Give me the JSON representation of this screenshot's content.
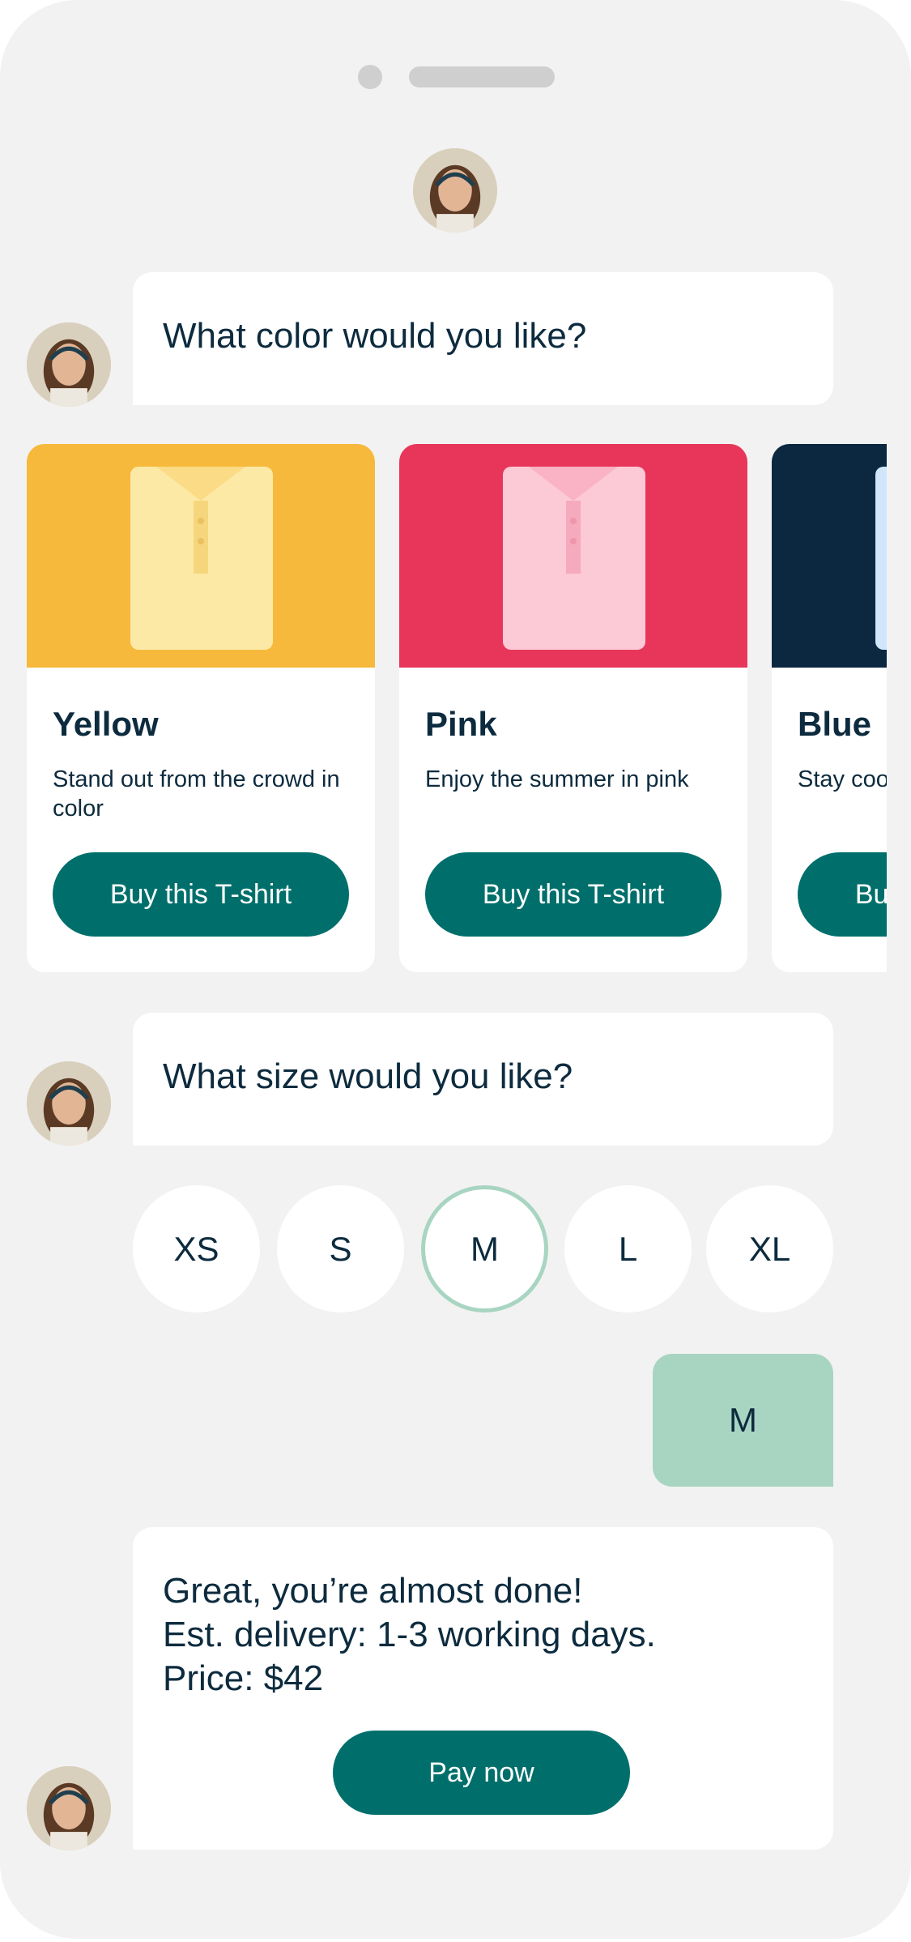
{
  "chat": {
    "messages": {
      "color_question": "What color would you like?",
      "size_question": "What size would you like?",
      "user_reply": "M",
      "final_lines": [
        "Great, you’re almost done!",
        "Est. delivery: 1-3 working days.",
        "Price: $42"
      ],
      "pay_label": "Pay now"
    },
    "products": [
      {
        "title": "Yellow",
        "description": "Stand out from the crowd in color",
        "button": "Buy this T-shirt",
        "bg": "#f6b93b",
        "shirt": "#fde9a6"
      },
      {
        "title": "Pink",
        "description": "Enjoy the summer in pink",
        "button": "Buy this T-shirt",
        "bg": "#e8365a",
        "shirt": "#fcc9d6"
      },
      {
        "title": "Blue",
        "description": "Stay cool in blue",
        "button": "Buy this T-shirt",
        "bg": "#0c2740",
        "shirt": "#cfe6fb"
      }
    ],
    "sizes": [
      {
        "label": "XS",
        "selected": false
      },
      {
        "label": "S",
        "selected": false
      },
      {
        "label": "M",
        "selected": true
      },
      {
        "label": "L",
        "selected": false
      },
      {
        "label": "XL",
        "selected": false
      }
    ]
  },
  "colors": {
    "accent": "#006f6b",
    "selected_ring": "#a8d5c2",
    "reply_bubble": "#a8d5c2",
    "background": "#f2f2f2",
    "text": "#0d2b3e"
  }
}
